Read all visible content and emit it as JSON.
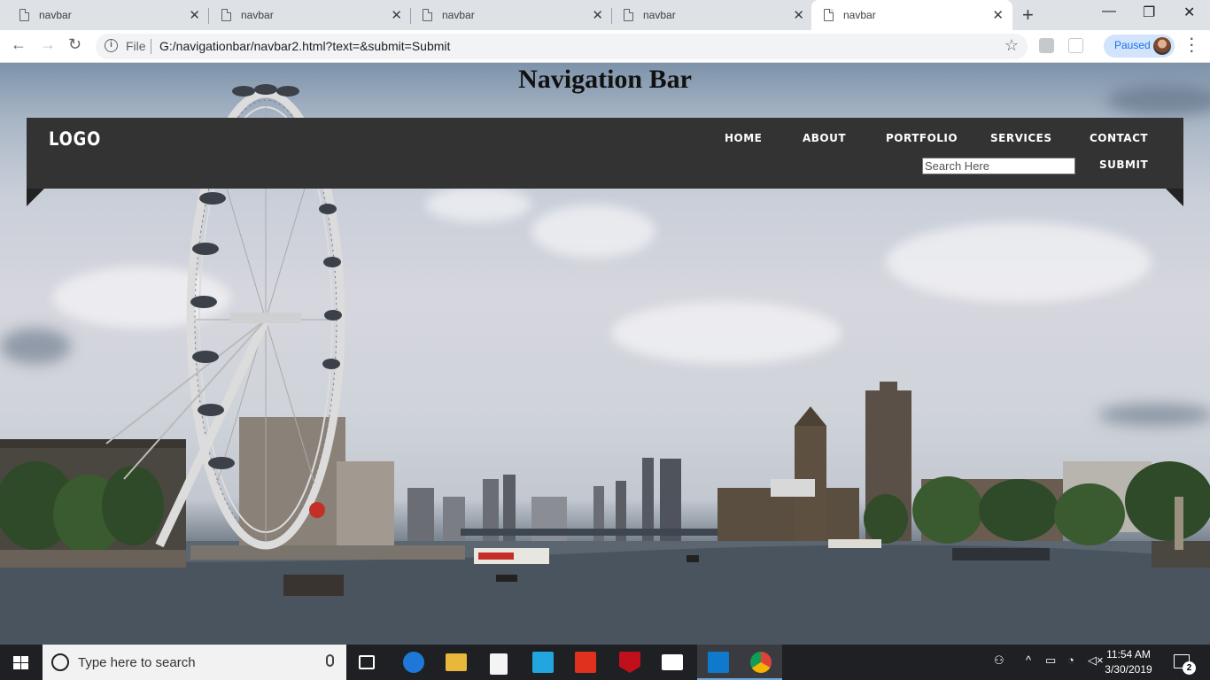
{
  "browser": {
    "tabs": [
      {
        "label": "navbar",
        "active": false
      },
      {
        "label": "navbar",
        "active": false
      },
      {
        "label": "navbar",
        "active": false
      },
      {
        "label": "navbar",
        "active": false
      },
      {
        "label": "navbar",
        "active": true
      }
    ],
    "new_tab_label": "+",
    "window_controls": {
      "minimize": "—",
      "restore": "❐",
      "close": "✕"
    },
    "nav": {
      "back": "←",
      "forward": "→",
      "reload": "↻"
    },
    "omnibox": {
      "scheme_label": "File",
      "url": "G:/navigationbar/navbar2.html?text=&submit=Submit"
    },
    "star_icon": "☆",
    "profile_label": "Paused"
  },
  "page": {
    "heading": "Navigation Bar",
    "navbar": {
      "logo": "LOGO",
      "links": [
        "HOME",
        "ABOUT",
        "PORTFOLIO",
        "SERVICES",
        "CONTACT"
      ],
      "search_placeholder": "Search Here",
      "submit_label": "SUBMIT"
    }
  },
  "taskbar": {
    "search_placeholder": "Type here to search",
    "clock_time": "11:54 AM",
    "clock_date": "3/30/2019",
    "notification_count": "2"
  },
  "colors": {
    "navbar_bg": "#333333",
    "navbar_text": "#ffffff",
    "taskbar_bg": "#1f2023"
  }
}
